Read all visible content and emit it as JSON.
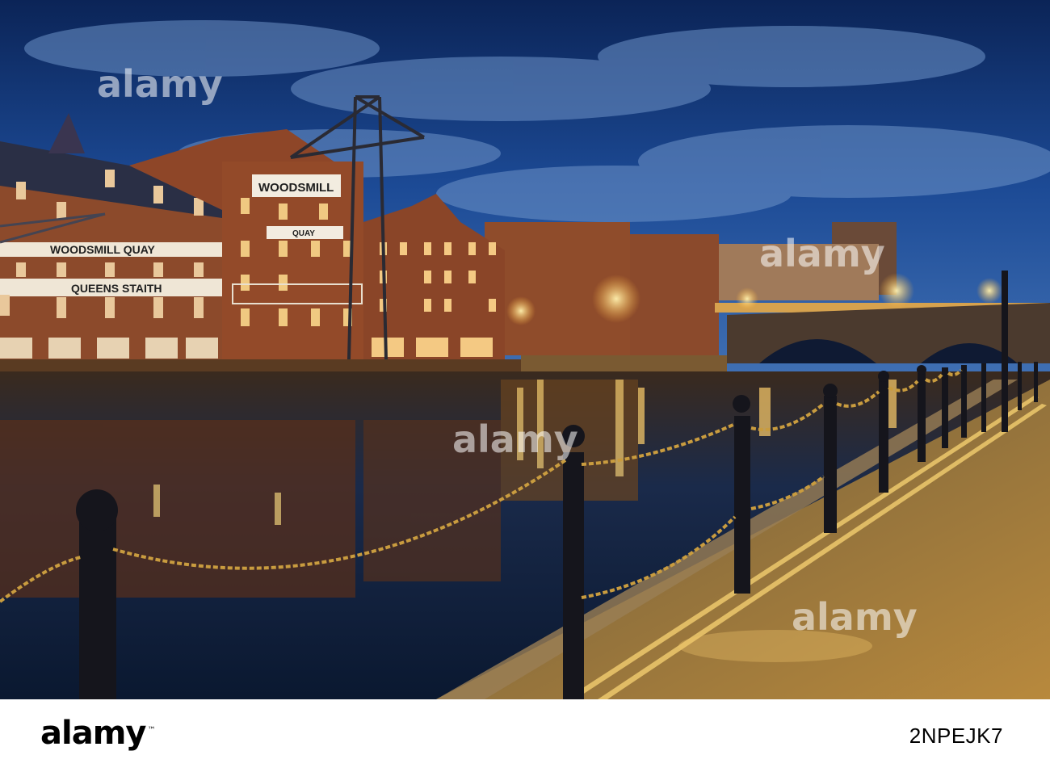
{
  "photo": {
    "building_signs": {
      "woodsmill": "WOODSMILL",
      "quay": "QUAY",
      "woodsmill_quay": "WOODSMILL QUAY",
      "queens_staith": "QUEENS STAITH"
    },
    "watermark": "alamy"
  },
  "footer": {
    "logo": "alamy",
    "image_id": "2NPEJK7"
  },
  "colors": {
    "sky": "#163a78",
    "water": "#0e1f3d",
    "brick": "#8a4a2a",
    "lights": "#ffcf6b"
  }
}
